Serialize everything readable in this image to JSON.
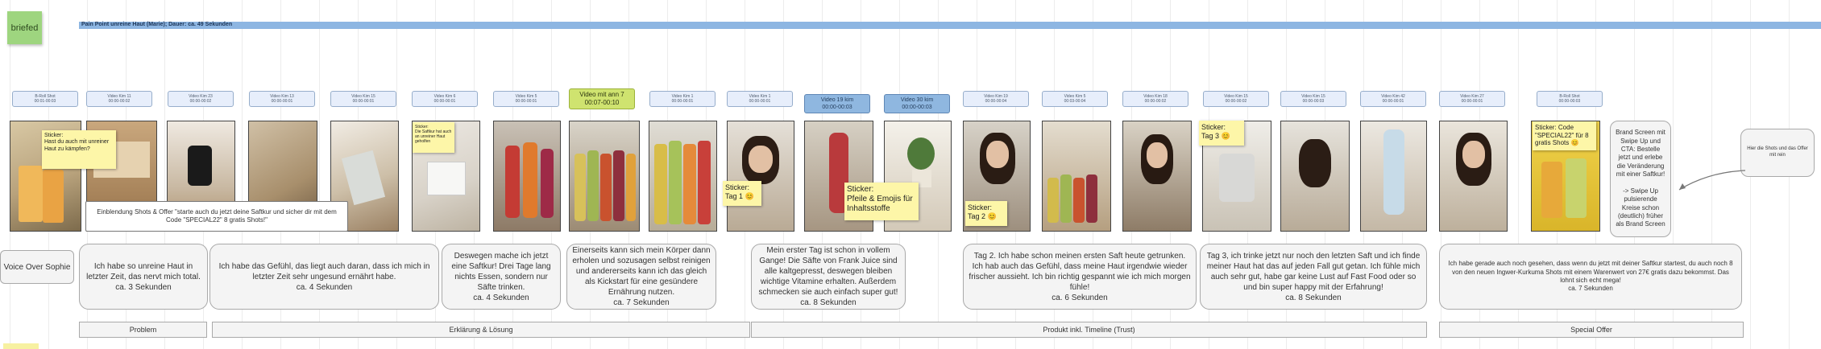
{
  "sticky_label": "briefed",
  "pain_point": "Pain Point unreine Haut  (Marie); Dauer: ca. 49 Sekunden",
  "labels": [
    {
      "text": "B-Roll Shot\n00:01-00:03",
      "style": "normal"
    },
    {
      "text": "Video Kim 11\n00:00-00:02",
      "style": "normal"
    },
    {
      "text": "Video Kim 23\n00:00-00:02",
      "style": "normal"
    },
    {
      "text": "Video Kim 13\n00:00-00:01",
      "style": "normal"
    },
    {
      "text": "Video Kim 15\n00:00-00:01",
      "style": "normal"
    },
    {
      "text": "Video Kim 6\n00:00-00:01",
      "style": "normal"
    },
    {
      "text": "Video Kim 5\n00:00-00:01",
      "style": "normal"
    },
    {
      "text": "Video mit ann 7\n00:07-00:10",
      "style": "green"
    },
    {
      "text": "Video Kim 1\n00:00-00:01",
      "style": "normal"
    },
    {
      "text": "Video Kim 1\n00:00-00:01",
      "style": "normal"
    },
    {
      "text": "Video 19 kim\n00:00-00:03",
      "style": "blue"
    },
    {
      "text": "Video 30 kim\n00:00-00:03",
      "style": "blue"
    },
    {
      "text": "Video Kim 19\n00:00-00:04",
      "style": "normal"
    },
    {
      "text": "Video Kim 5\n00:03-00:04",
      "style": "normal"
    },
    {
      "text": "Video Kim 18\n00:00-00:02",
      "style": "normal"
    },
    {
      "text": "Video Kim 15\n00:00-00:02",
      "style": "normal"
    },
    {
      "text": "Video Kim 15\n00:00-00:03",
      "style": "normal"
    },
    {
      "text": "Video Kim 42\n00:00-00:01",
      "style": "normal"
    },
    {
      "text": "Video Kim 27\n00:00-00:01",
      "style": "normal"
    },
    {
      "text": "B-Roll Shot\n00:00-00:03",
      "style": "normal"
    }
  ],
  "stickers": [
    "Sticker:\nHast du auch mit unreiner Haut zu kämpfen?",
    "Sticker:\nDie Saftkur hat auch an unreiner Haut geholfen",
    "Sticker:\nTag 1 😊",
    "Sticker:\nPfeile & Emojis für Inhaltsstoffe",
    "Sticker:\nTag 2 😊",
    "Sticker:\nTag 3 😊",
    "Sticker: Code \"SPECIAL22\" für 8 gratis Shots 😊"
  ],
  "banner": "Einblendung Shots & Offer \"starte auch du jetzt deine Saftkur und sicher dir mit dem Code \"SPECIAL22\" 8 gratis Shots!\"",
  "end_screen": "Brand Screen mit Swipe Up und CTA: Bestelle jetzt und erlebe die Veränderung mit einer Saftkur!\n\n-> Swipe Up pulsierende Kreise schon (deutlich) früher als Brand Screen",
  "side_note": "Hier die Shots und das Offer mit rein",
  "voice_label": "Voice Over Sophie",
  "voiceover": [
    "Ich habe so unreine Haut in letzter Zeit, das nervt mich total.\nca. 3 Sekunden",
    "Ich habe das Gefühl, das liegt auch daran, dass ich mich in letzter Zeit sehr ungesund ernährt habe.\nca. 4 Sekunden",
    "Deswegen mache ich jetzt eine Saftkur! Drei Tage lang nichts Essen, sondern nur Säfte trinken.\nca. 4 Sekunden",
    "Einerseits kann sich mein Körper dann erholen und sozusagen selbst reinigen und andererseits kann ich das gleich als Kickstart für eine gesündere Ernährung nutzen.\nca. 7 Sekunden",
    "Mein erster Tag ist schon in vollem Gange! Die Säfte von Frank Juice sind alle kaltgepresst, deswegen bleiben wichtige Vitamine erhalten. Außerdem schmecken sie auch einfach super gut!\nca. 8 Sekunden",
    "Tag 2. Ich habe schon meinen ersten Saft heute getrunken. Ich hab auch das Gefühl, dass meine Haut irgendwie wieder frischer aussieht. Ich bin richtig gespannt wie ich mich morgen fühle!\nca. 6 Sekunden",
    "Tag 3, ich trinke jetzt nur noch den letzten Saft und ich finde meiner Haut hat das auf jeden Fall gut getan. Ich fühle mich auch sehr gut, habe gar keine Lust auf Fast Food oder so und bin super happy mit der Erfahrung!\nca. 8 Sekunden",
    "Ich habe gerade auch noch gesehen, dass wenn du jetzt mit deiner Saftkur startest, du auch noch 8 von den neuen Ingwer-Kurkuma Shots mit einem Warenwert von 27€ gratis dazu bekommst. Das lohnt sich echt mega!\nca. 7 Sekunden"
  ],
  "sections": [
    "Problem",
    "Erklärung & Lösung",
    "Produkt inkl. Timeline (Trust)",
    "Special Offer"
  ],
  "colors": {
    "sticky": "#9ed57f",
    "pain_bar": "#8db6e2",
    "label": "#e7eefb",
    "label_green": "#cfe36f",
    "label_blue": "#8fb7e0",
    "note": "#fdf6a8"
  }
}
